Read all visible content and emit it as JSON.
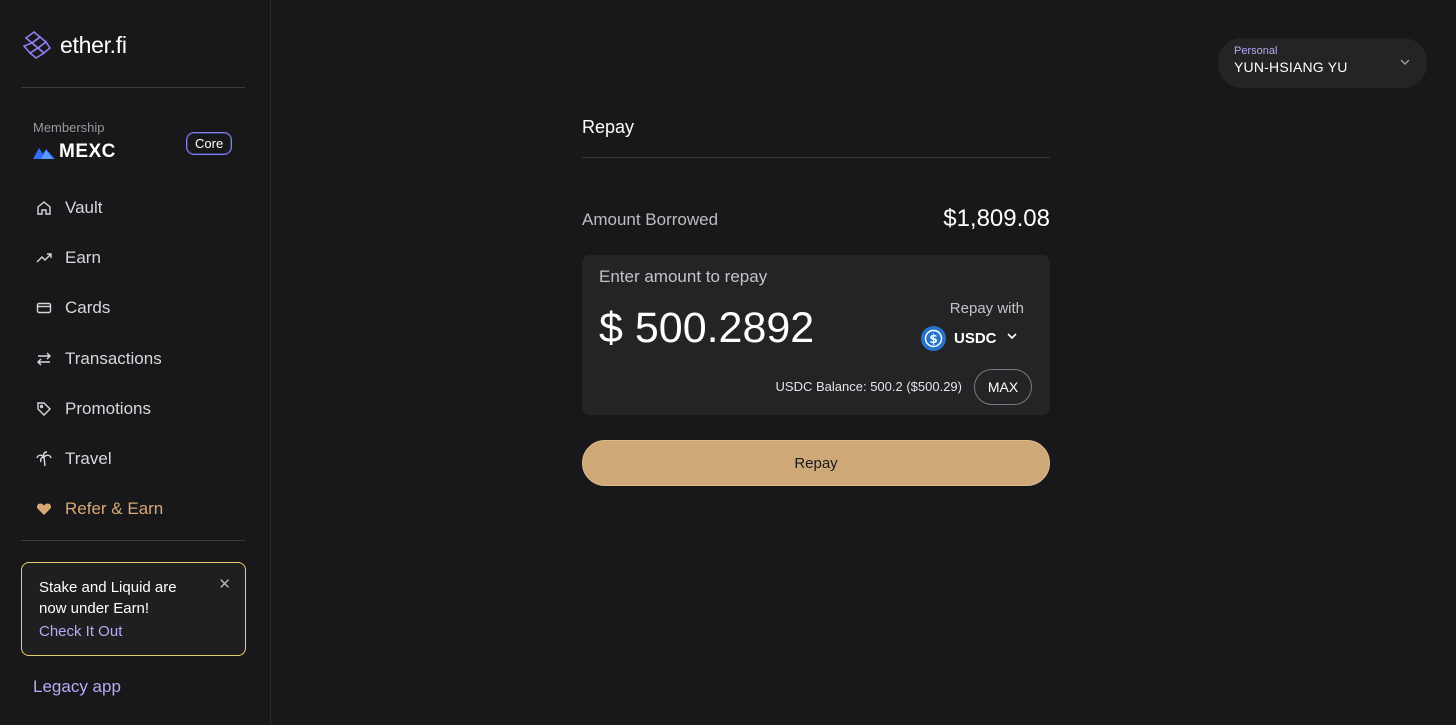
{
  "brand": {
    "name": "ether.fi"
  },
  "membership": {
    "label": "Membership",
    "partner": "MEXC",
    "tier": "Core"
  },
  "sidebar": {
    "items": [
      {
        "label": "Vault",
        "icon": "home-icon"
      },
      {
        "label": "Earn",
        "icon": "trending-up-icon"
      },
      {
        "label": "Cards",
        "icon": "credit-card-icon"
      },
      {
        "label": "Transactions",
        "icon": "arrows-swap-icon"
      },
      {
        "label": "Promotions",
        "icon": "tag-icon"
      },
      {
        "label": "Travel",
        "icon": "palm-tree-icon"
      },
      {
        "label": "Refer & Earn",
        "icon": "heart-icon"
      }
    ]
  },
  "promo": {
    "text": "Stake and Liquid are now under Earn!",
    "link": "Check It Out"
  },
  "legacy": {
    "label": "Legacy app"
  },
  "account": {
    "type": "Personal",
    "name": "YUN-HSIANG YU"
  },
  "repay": {
    "title": "Repay",
    "borrowed_label": "Amount Borrowed",
    "borrowed_value": "$1,809.08",
    "enter_label": "Enter amount to repay",
    "amount": "$ 500.2892",
    "repay_with_label": "Repay with",
    "token": "USDC",
    "balance": "USDC Balance: 500.2 ($500.29)",
    "max_label": "MAX",
    "button_label": "Repay"
  },
  "colors": {
    "background": "#18181a",
    "accent_gold": "#cfa878",
    "accent_purple": "#b9a8f5",
    "promo_border": "#e6cf6e"
  }
}
